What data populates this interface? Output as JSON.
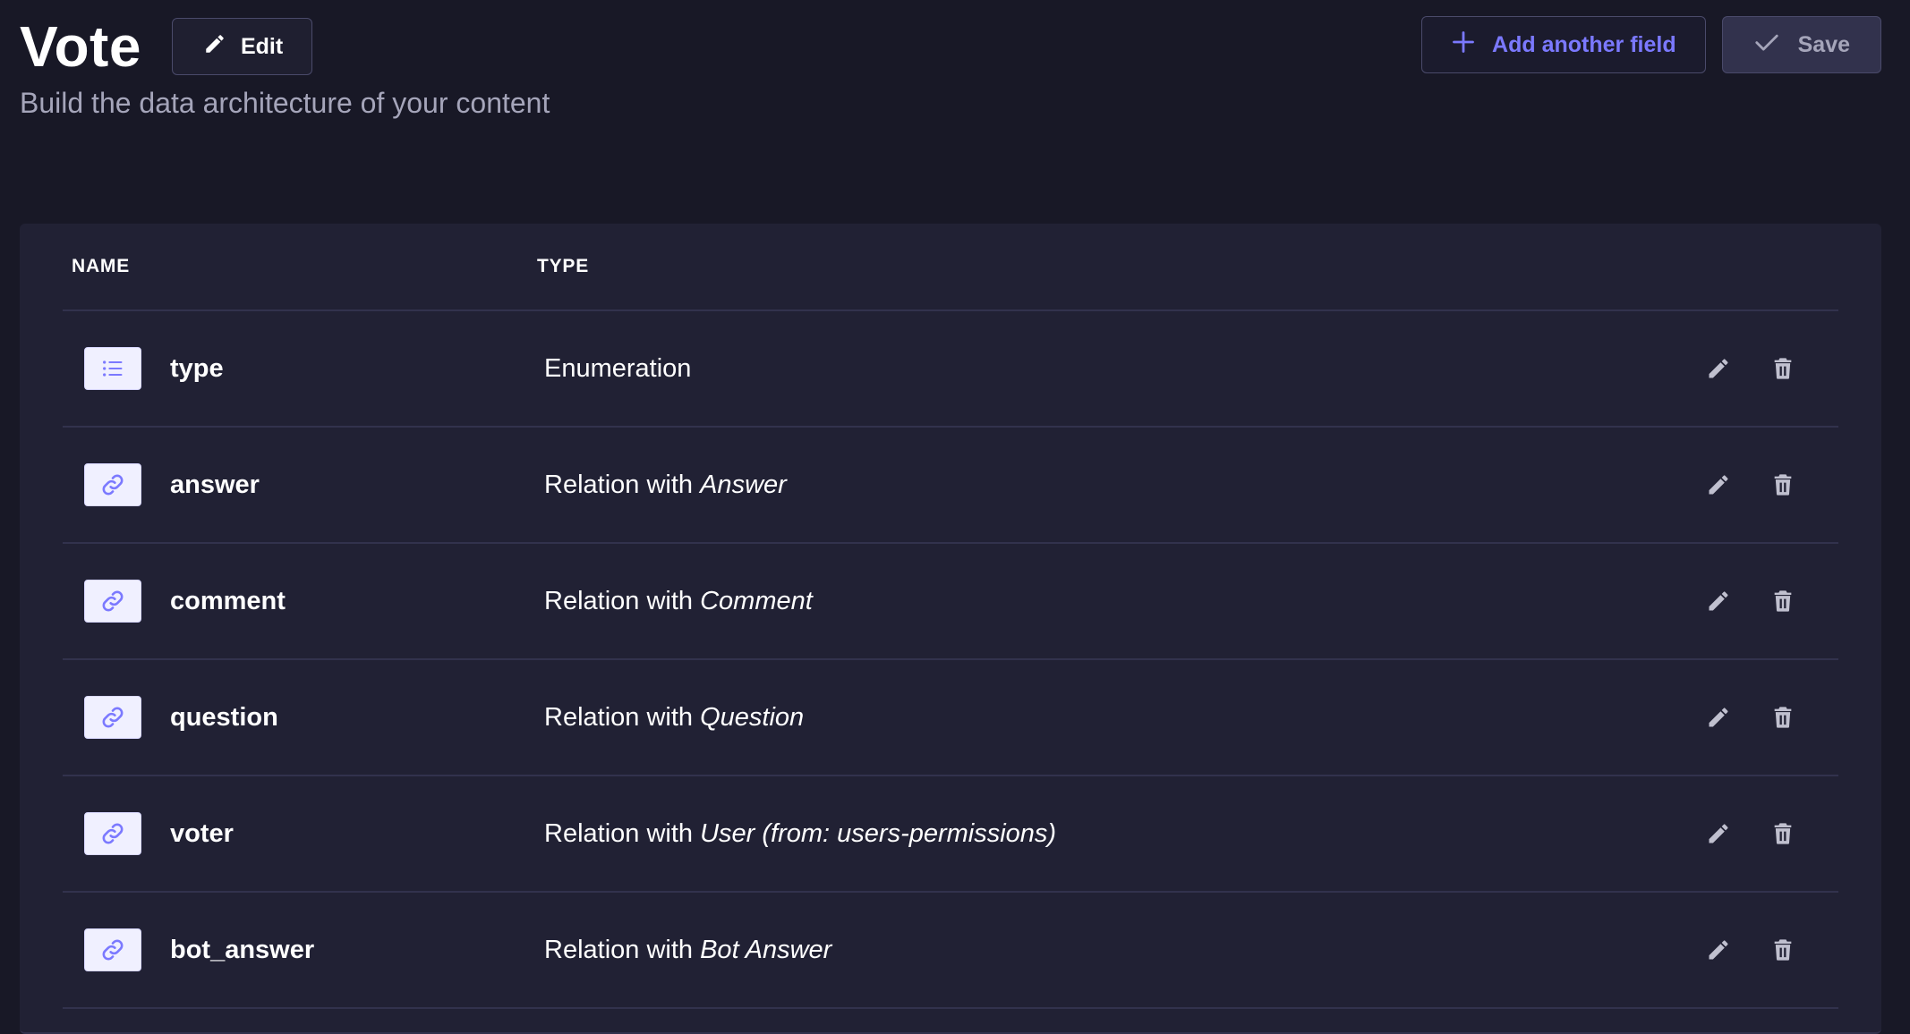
{
  "header": {
    "title": "Vote",
    "edit_label": "Edit",
    "subtitle": "Build the data architecture of your content",
    "add_field_label": "Add another field",
    "save_label": "Save"
  },
  "table": {
    "columns": [
      "NAME",
      "TYPE"
    ],
    "rows": [
      {
        "icon": "list-icon",
        "name": "type",
        "type_prefix": "Enumeration",
        "type_target": ""
      },
      {
        "icon": "link-icon",
        "name": "answer",
        "type_prefix": "Relation with ",
        "type_target": "Answer"
      },
      {
        "icon": "link-icon",
        "name": "comment",
        "type_prefix": "Relation with ",
        "type_target": "Comment"
      },
      {
        "icon": "link-icon",
        "name": "question",
        "type_prefix": "Relation with ",
        "type_target": "Question"
      },
      {
        "icon": "link-icon",
        "name": "voter",
        "type_prefix": "Relation with ",
        "type_target": "User (from: users-permissions)"
      },
      {
        "icon": "link-icon",
        "name": "bot_answer",
        "type_prefix": "Relation with ",
        "type_target": "Bot Answer"
      }
    ]
  },
  "colors": {
    "background": "#181826",
    "card": "#212134",
    "accent": "#7b79ff",
    "muted_text": "#a5a5ba",
    "border": "#32324d"
  }
}
